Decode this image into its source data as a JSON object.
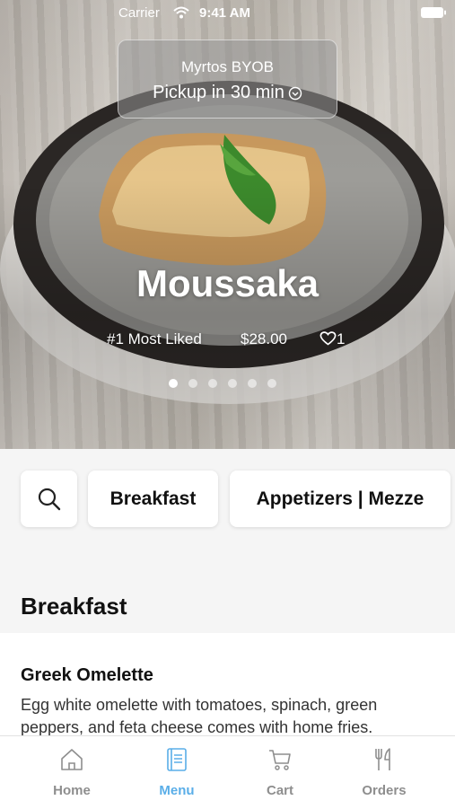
{
  "status_bar": {
    "carrier": "Carrier",
    "time": "9:41 AM"
  },
  "pickup": {
    "restaurant": "Myrtos BYOB",
    "line": "Pickup in 30 min"
  },
  "featured": {
    "title": "Moussaka",
    "rank": "#1 Most Liked",
    "price": "$28.00",
    "likes": "1",
    "slide_count": 6,
    "active_slide": 1
  },
  "categories": {
    "first": "Breakfast",
    "second": "Appetizers | Mezze"
  },
  "section": {
    "title": "Breakfast"
  },
  "menu_item": {
    "name": "Greek Omelette",
    "description": "Egg white omelette with tomatoes, spinach, green peppers, and feta cheese comes with home fries."
  },
  "tabs": {
    "home": "Home",
    "menu": "Menu",
    "cart": "Cart",
    "orders": "Orders",
    "active": "Menu"
  },
  "colors": {
    "accent": "#5aaee8",
    "tab_inactive": "#8e8e8e"
  }
}
